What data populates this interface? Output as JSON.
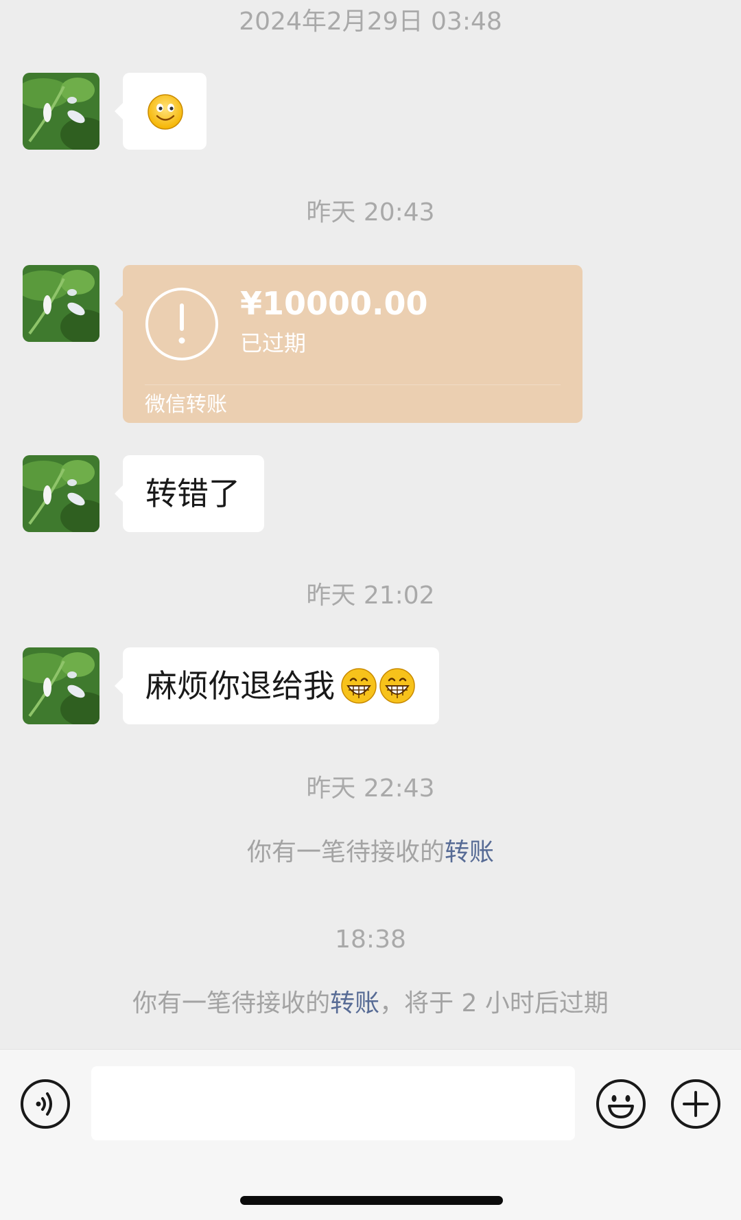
{
  "messages": {
    "timestamps": [
      "2024年2月29日 03:48",
      "昨天 20:43",
      "昨天 21:02",
      "昨天 22:43",
      "18:38"
    ],
    "smile_bubble": {
      "emoji": "smile-emoji"
    },
    "transfer": {
      "amount": "¥10000.00",
      "status": "已过期",
      "label": "微信转账"
    },
    "text_1": "转错了",
    "text_2": "麻烦你退给我",
    "text_2_emoji": "grin-emoji",
    "notice_1": {
      "prefix": "你有一笔待接收的",
      "link": "转账",
      "suffix": ""
    },
    "notice_2": {
      "prefix": "你有一笔待接收的",
      "link": "转账",
      "suffix": "，将于 2 小时后过期"
    }
  },
  "input_bar": {
    "voice_icon": "voice-icon",
    "emoji_icon": "emoji-icon",
    "plus_icon": "plus-icon",
    "text_value": ""
  },
  "colors": {
    "background": "#ededed",
    "transfer_card": "#ebcfb1",
    "link": "#576b95"
  }
}
